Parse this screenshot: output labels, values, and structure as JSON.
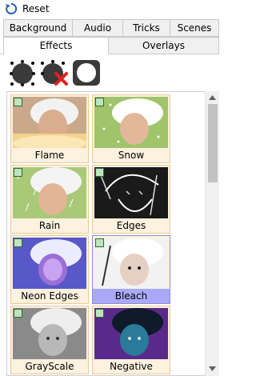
{
  "reset": {
    "label": "Reset",
    "icon": "reset-arrow-icon"
  },
  "tabs_row1": [
    {
      "label": "Background"
    },
    {
      "label": "Audio"
    },
    {
      "label": "Tricks"
    },
    {
      "label": "Scenes"
    }
  ],
  "tabs_row2": [
    {
      "label": "Effects",
      "active": true
    },
    {
      "label": "Overlays",
      "active": false
    }
  ],
  "tools": [
    {
      "icon": "select-all-icon"
    },
    {
      "icon": "deselect-all-icon"
    },
    {
      "icon": "clear-icon"
    }
  ],
  "effects": [
    {
      "label": "Flame",
      "selected": false
    },
    {
      "label": "Snow",
      "selected": false
    },
    {
      "label": "Rain",
      "selected": false
    },
    {
      "label": "Edges",
      "selected": false
    },
    {
      "label": "Neon Edges",
      "selected": false
    },
    {
      "label": "Bleach",
      "selected": true
    },
    {
      "label": "GrayScale",
      "selected": false
    },
    {
      "label": "Negative",
      "selected": false
    }
  ],
  "colors": {
    "tile_border": "#f0c896",
    "tile_bg": "#fdf1e0",
    "selected_label_bg": "#a9a9f7",
    "checkbox": "#bfe3bf"
  }
}
